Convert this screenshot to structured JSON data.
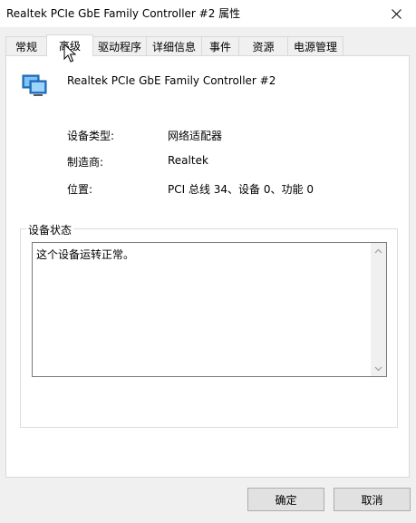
{
  "window": {
    "title": "Realtek PCIe GbE Family Controller #2 属性"
  },
  "tabs": [
    {
      "label": "常规"
    },
    {
      "label": "高级"
    },
    {
      "label": "驱动程序"
    },
    {
      "label": "详细信息"
    },
    {
      "label": "事件"
    },
    {
      "label": "资源"
    },
    {
      "label": "电源管理"
    }
  ],
  "active_tab": "高级",
  "device": {
    "name": "Realtek PCIe GbE Family Controller #2",
    "icon": "network-adapter-icon",
    "properties": [
      {
        "label": "设备类型:",
        "value": "网络适配器"
      },
      {
        "label": "制造商:",
        "value": "Realtek"
      },
      {
        "label": "位置:",
        "value": "PCI 总线 34、设备 0、功能 0"
      }
    ]
  },
  "status": {
    "group_title": "设备状态",
    "text": "这个设备运转正常。"
  },
  "buttons": {
    "ok": "确定",
    "cancel": "取消"
  },
  "colors": {
    "panel_bg": "#ffffff",
    "window_bg": "#f0f0f0",
    "border": "#d9d9d9",
    "button_bg": "#e1e1e1"
  }
}
